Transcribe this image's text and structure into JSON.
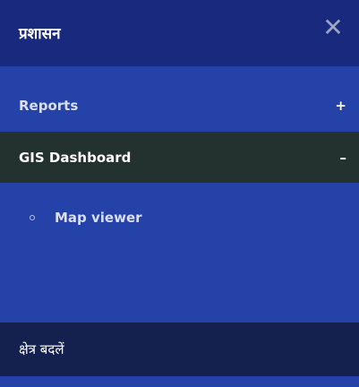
{
  "header": {
    "title": "प्रशासन",
    "close_symbol": "✕"
  },
  "menu": {
    "items": [
      {
        "label": "Reports",
        "toggle": "+",
        "expanded": false
      },
      {
        "label": "GIS Dashboard",
        "toggle": "–",
        "expanded": true
      }
    ],
    "subitems": [
      {
        "label": "Map viewer"
      }
    ]
  },
  "footer": {
    "label": "क्षेत्र बदलें"
  },
  "colors": {
    "header_bg": "#18297e",
    "panel_bg": "#2542a8",
    "active_item_bg": "#24322f",
    "footer_bg": "#14204e"
  }
}
